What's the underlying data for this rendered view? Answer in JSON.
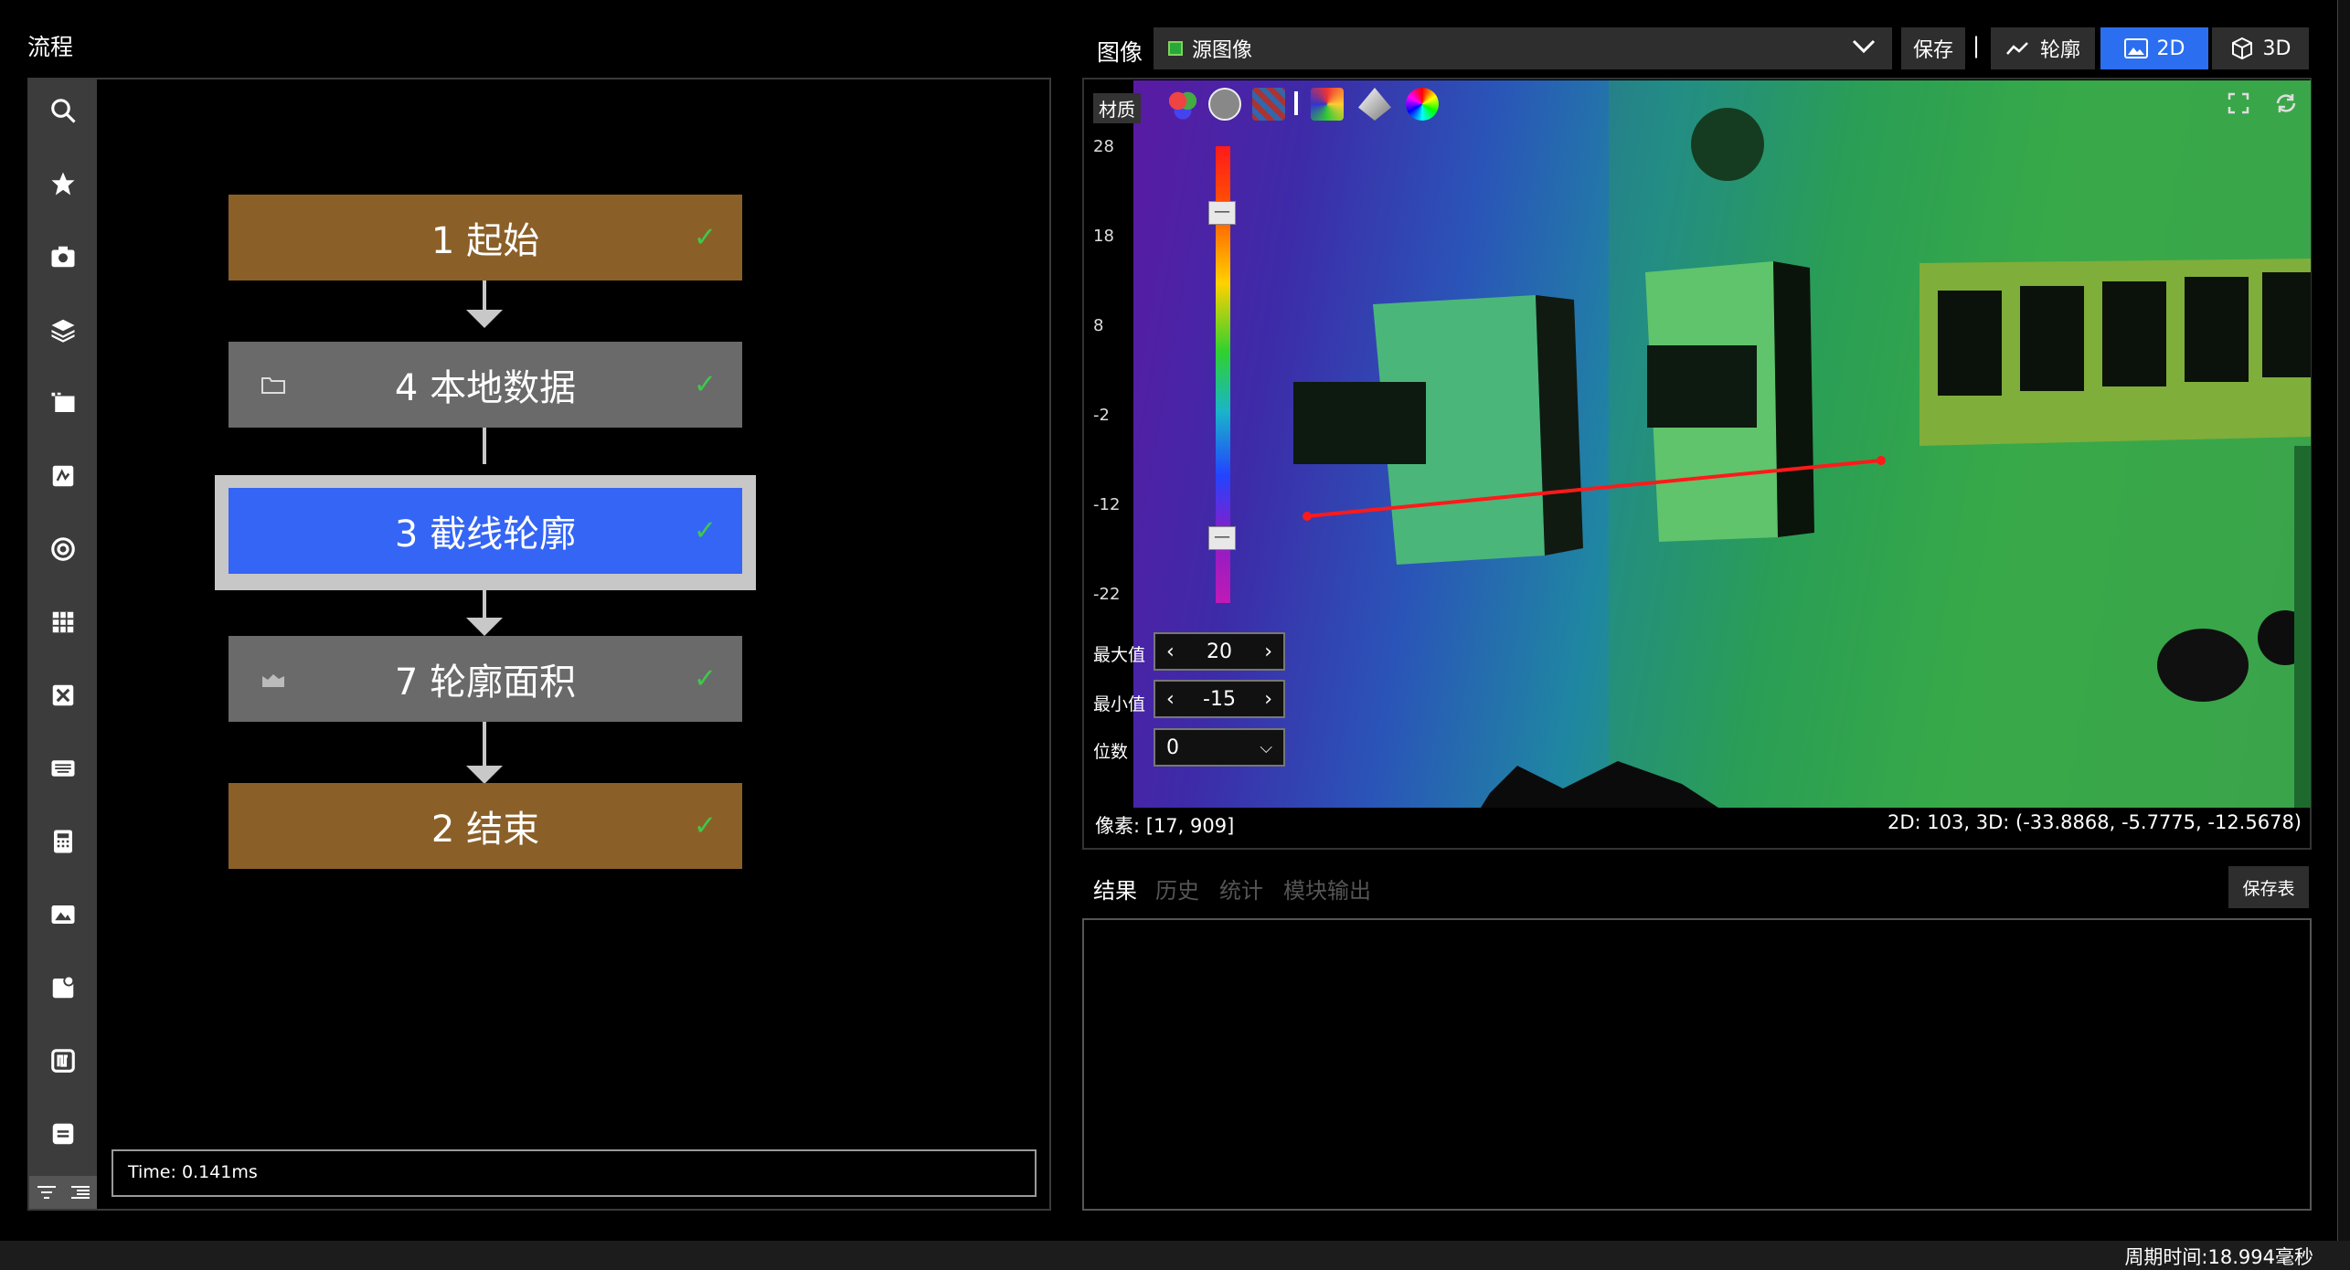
{
  "flow": {
    "title": "流程",
    "nodes": [
      {
        "label": "1 起始",
        "check": "✓"
      },
      {
        "label": "4 本地数据",
        "check": "✓"
      },
      {
        "label": "3 截线轮廓",
        "check": "✓"
      },
      {
        "label": "7 轮廓面积",
        "check": "✓"
      },
      {
        "label": "2 结束",
        "check": "✓"
      }
    ],
    "time": "Time: 0.141ms"
  },
  "image_panel": {
    "title": "图像",
    "source": "源图像",
    "buttons": {
      "save": "保存",
      "separator": "|",
      "profile": "轮廓",
      "twod": "2D",
      "threed": "3D"
    },
    "material": "材质",
    "scale_ticks": [
      "28",
      "18",
      "8",
      "-2",
      "-12",
      "-22"
    ],
    "max_label": "最大值",
    "max_value": "20",
    "min_label": "最小值",
    "min_value": "-15",
    "digits_label": "位数",
    "digits_value": "0",
    "pixel": "像素: [17, 909]",
    "coords": "2D: 103, 3D: (-33.8868, -5.7775, -12.5678)"
  },
  "results": {
    "tabs": [
      "结果",
      "历史",
      "统计",
      "模块输出"
    ],
    "save_table": "保存表"
  },
  "status": {
    "cycle_time": "周期时间:18.994毫秒"
  },
  "colors": {
    "accent": "#3565f5",
    "node_brown": "#8b6028",
    "node_gray": "#6a6a6a",
    "check": "#3ec94b",
    "profile_line": "#ff1a1a"
  }
}
